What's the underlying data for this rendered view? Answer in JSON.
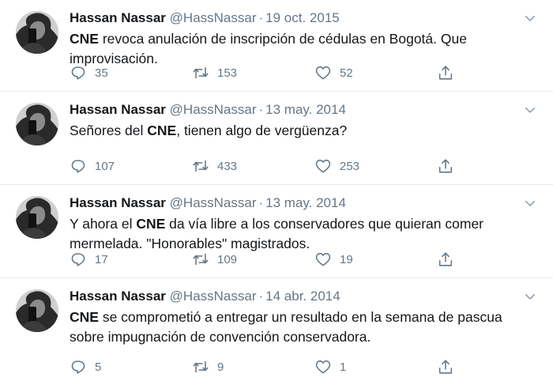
{
  "tweets": [
    {
      "name": "Hassan Nassar",
      "handle": "@HassNassar",
      "separator": "·",
      "date": "19 oct. 2015",
      "text_bold": "CNE",
      "text_rest": " revoca anulación de inscripción de cédulas en Bogotá. Que improvisación.",
      "text_pre": "",
      "replies": "35",
      "retweets": "153",
      "likes": "52"
    },
    {
      "name": "Hassan Nassar",
      "handle": "@HassNassar",
      "separator": "·",
      "date": "13 may. 2014",
      "text_pre": "Señores del ",
      "text_bold": "CNE",
      "text_rest": ", tienen algo de vergüenza?",
      "replies": "107",
      "retweets": "433",
      "likes": "253"
    },
    {
      "name": "Hassan Nassar",
      "handle": "@HassNassar",
      "separator": "·",
      "date": "13 may. 2014",
      "text_pre": "Y ahora el ",
      "text_bold": "CNE",
      "text_rest": " da vía libre a los conservadores que quieran comer mermelada. \"Honorables\" magistrados.",
      "replies": "17",
      "retweets": "109",
      "likes": "19"
    },
    {
      "name": "Hassan Nassar",
      "handle": "@HassNassar",
      "separator": "·",
      "date": "14 abr. 2014",
      "text_pre": "",
      "text_bold": "CNE",
      "text_rest": " se comprometió a entregar un resultado en la semana de pascua sobre impugnación de convención conservadora.",
      "replies": "5",
      "retweets": "9",
      "likes": "1"
    }
  ],
  "icons": {
    "reply": "reply-icon",
    "retweet": "retweet-icon",
    "like": "like-icon",
    "share": "share-icon",
    "caret": "chevron-down-icon"
  },
  "colors": {
    "text": "#14171a",
    "secondary": "#657786",
    "divider": "#e6ecf0"
  }
}
